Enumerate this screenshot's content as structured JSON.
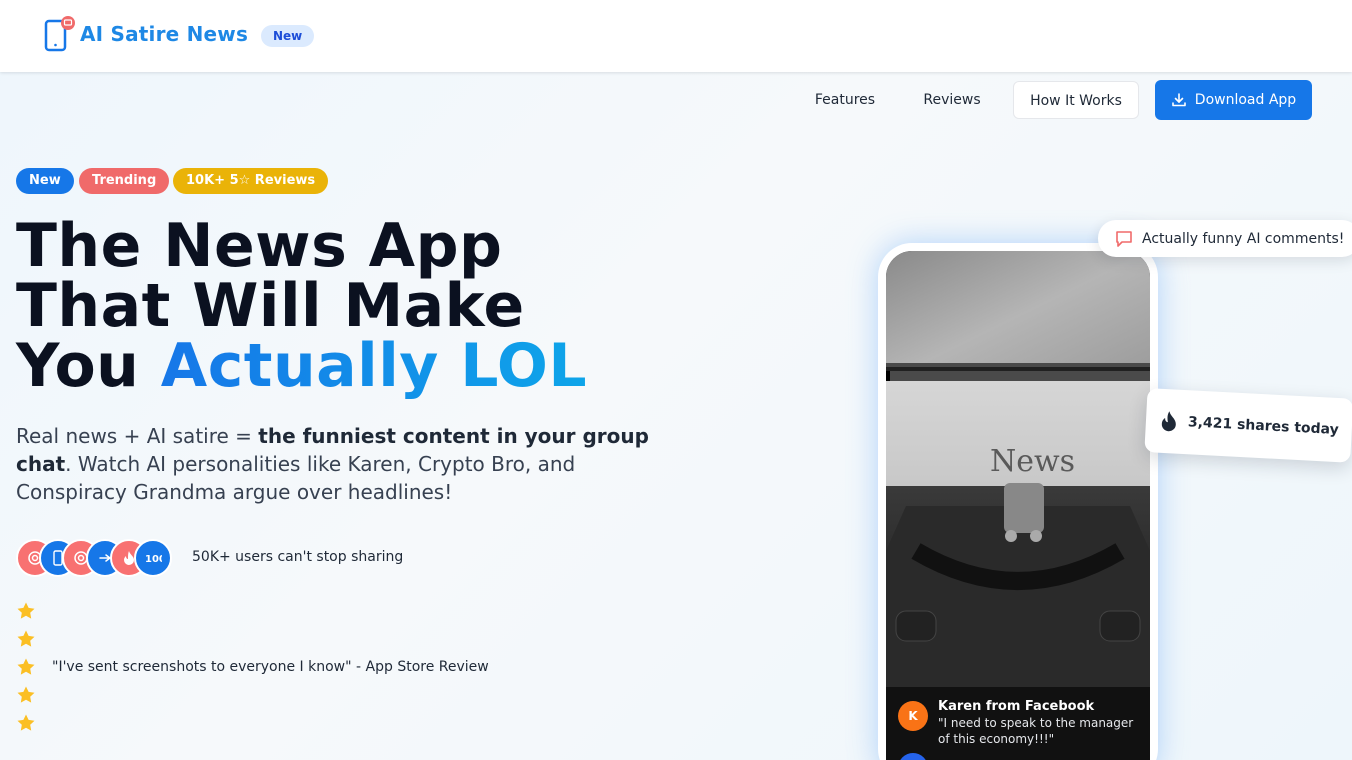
{
  "header": {
    "logo_text": "AI Satire News",
    "badge": "New"
  },
  "nav": {
    "features": "Features",
    "reviews": "Reviews",
    "how_it_works": "How It Works",
    "download": "Download App"
  },
  "tags": [
    "New",
    "Trending",
    "10K+ 5☆ Reviews"
  ],
  "hero": {
    "headline_line1": "The News App",
    "headline_line2": "That Will Make",
    "headline_line3_plain": "You ",
    "headline_line3_accent": "Actually LOL",
    "sub_before": "Real news + AI satire = ",
    "sub_bold": "the funniest content in your group chat",
    "sub_after": ". Watch AI personalities like Karen, Crypto Bro, and Conspiracy Grandma argue over headlines!"
  },
  "social_proof": {
    "avatar_icons": [
      "target-icon",
      "phone-icon",
      "target-icon",
      "rocket-icon",
      "fire-icon",
      "hundred-icon"
    ],
    "users_text": "50K+ users can't stop sharing",
    "star_count": 5,
    "review_quote": "\"I've sent screenshots to everyone I know\" - App Store Review"
  },
  "phone": {
    "screen_word": "News",
    "comment_initial": "K",
    "comment_name": "Karen from Facebook",
    "comment_text": "\"I need to speak to the manager of this economy!!!\""
  },
  "floating": {
    "comment_badge": "Actually funny AI comments!",
    "shares_badge": "3,421 shares today"
  },
  "colors": {
    "brand_blue": "#1677e8",
    "trending_red": "#f06a6a",
    "reviews_gold": "#eab308",
    "star_gold": "#fbbf24"
  }
}
